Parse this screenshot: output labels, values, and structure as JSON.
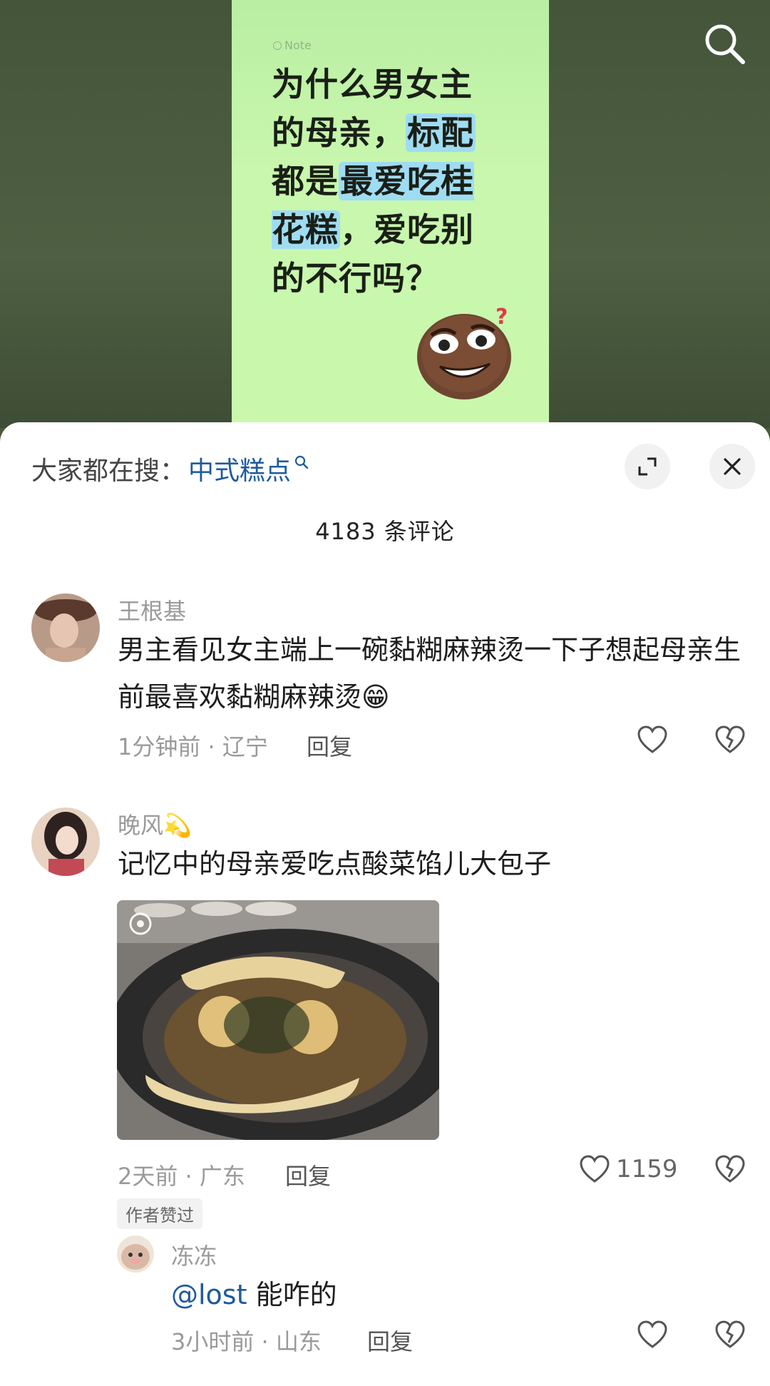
{
  "video": {
    "note_tag": "Note",
    "title_parts": [
      {
        "t": "为什么男女主的母亲，",
        "hl": false
      },
      {
        "t": "标配",
        "hl": true
      },
      {
        "t": "都是",
        "hl": false
      },
      {
        "t": "最爱吃桂花糕",
        "hl": true
      },
      {
        "t": "，爱吃别的不行吗？",
        "hl": false
      }
    ]
  },
  "sheet": {
    "search_prefix": "大家都在搜：",
    "search_keyword": "中式糕点",
    "comment_count": "4183 条评论"
  },
  "comments": [
    {
      "username": "王根基",
      "text": "男主看见女主端上一碗黏糊麻辣烫一下子想起母亲生前最喜欢黏糊麻辣烫😁",
      "meta": "1分钟前 · 辽宁",
      "reply": "回复",
      "likes": ""
    },
    {
      "username": "晚风💫",
      "text": "记忆中的母亲爱吃点酸菜馅儿大包子",
      "meta": "2天前 · 广东",
      "reply": "回复",
      "likes": "1159",
      "badge": "作者赞过"
    },
    {
      "username": "冻冻",
      "mention": "@lost",
      "text": " 能咋的",
      "meta": "3小时前 · 山东",
      "reply": "回复",
      "likes": ""
    }
  ],
  "colors": {
    "accent_blue": "#1f5a9e",
    "note_green": "#c9f8ad",
    "highlight": "#9fdcf2"
  }
}
